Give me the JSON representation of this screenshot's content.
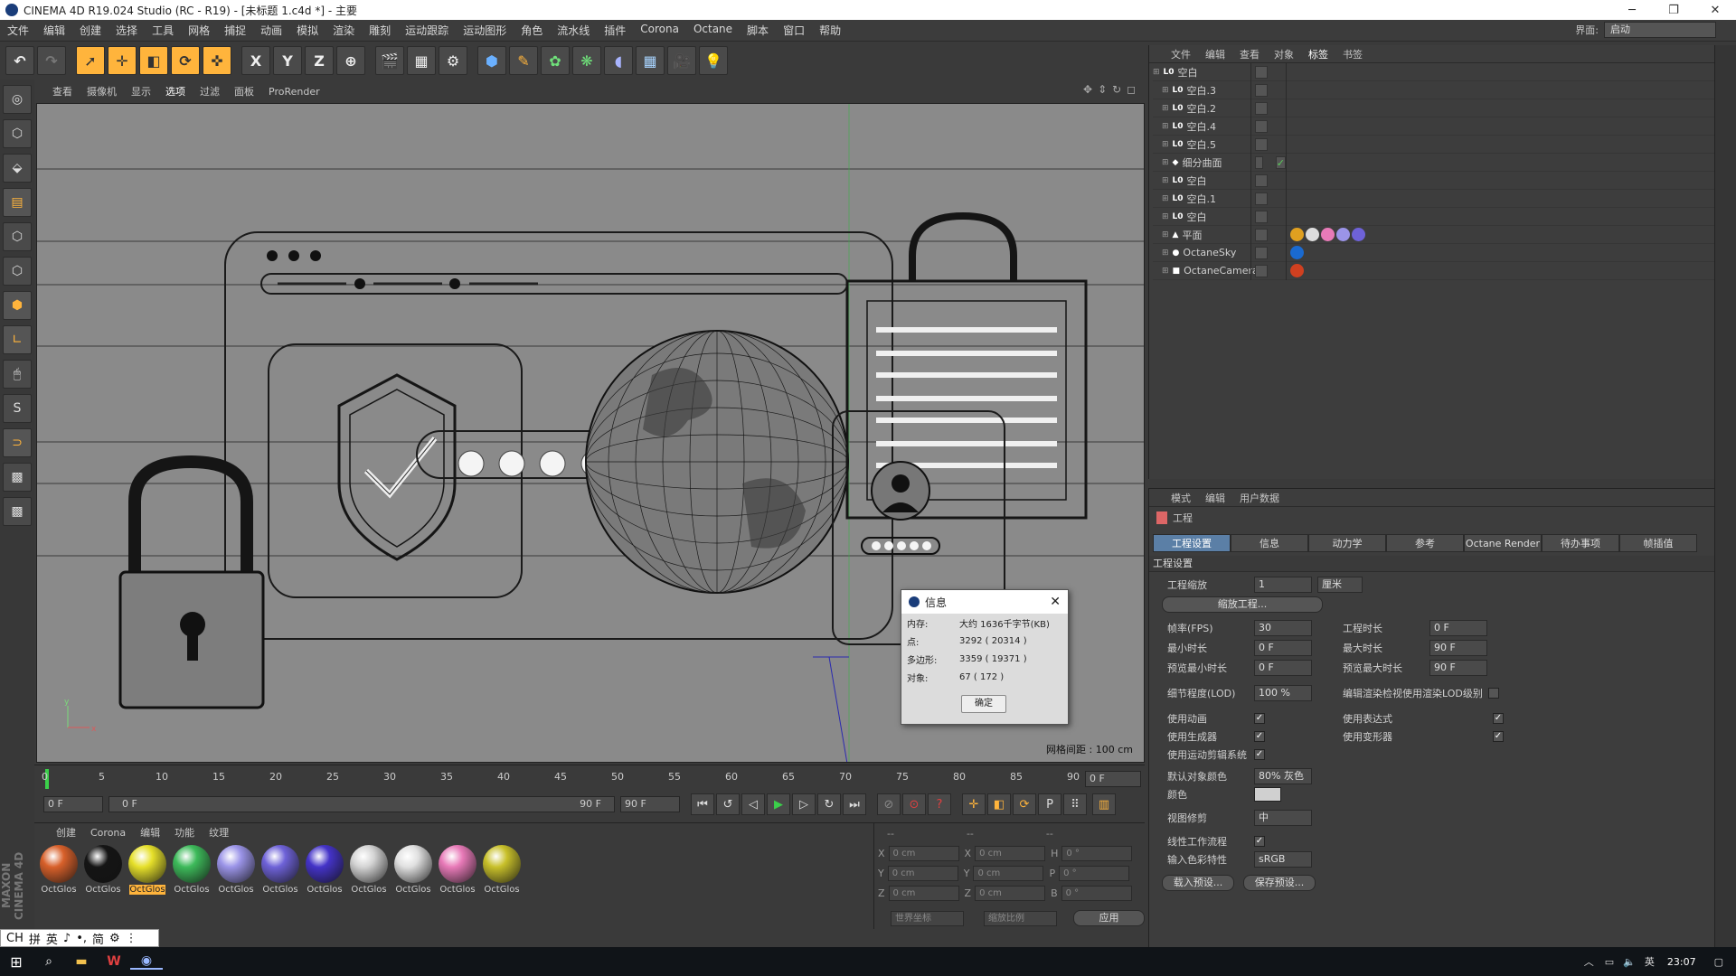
{
  "title": "CINEMA 4D R19.024 Studio (RC - R19) - [未标题 1.c4d *] - 主要",
  "menu": [
    "文件",
    "编辑",
    "创建",
    "选择",
    "工具",
    "网格",
    "捕捉",
    "动画",
    "模拟",
    "渲染",
    "雕刻",
    "运动跟踪",
    "运动图形",
    "角色",
    "流水线",
    "插件",
    "Corona",
    "Octane",
    "脚本",
    "窗口",
    "帮助"
  ],
  "layout": {
    "label": "界面:",
    "value": "启动"
  },
  "toolbar": {
    "x": "X",
    "y": "Y",
    "z": "Z"
  },
  "viewport": {
    "menu": [
      "查看",
      "摄像机",
      "显示",
      "选项",
      "过滤",
      "面板",
      "ProRender"
    ],
    "grid_label": "网格间距 : 100 cm"
  },
  "timeline": {
    "ticks": [
      "0",
      "5",
      "10",
      "15",
      "20",
      "25",
      "30",
      "35",
      "40",
      "45",
      "50",
      "55",
      "60",
      "65",
      "70",
      "75",
      "80",
      "85",
      "90"
    ],
    "current": "0 F",
    "start": "0 F",
    "range_start": "0 F",
    "range_end": "90 F",
    "end": "90 F"
  },
  "materials": {
    "menu": [
      "创建",
      "Corona",
      "编辑",
      "功能",
      "纹理"
    ],
    "items": [
      {
        "label": "OctGlos",
        "color": "#d8602a",
        "selected": false
      },
      {
        "label": "OctGlos",
        "color": "#151515",
        "selected": false
      },
      {
        "label": "OctGlos",
        "color": "#e6e02a",
        "selected": true
      },
      {
        "label": "OctGlos",
        "color": "#3dba5a",
        "selected": false
      },
      {
        "label": "OctGlos",
        "color": "#9b94e8",
        "selected": false
      },
      {
        "label": "OctGlos",
        "color": "#6e62d8",
        "selected": false
      },
      {
        "label": "OctGlos",
        "color": "#4433c8",
        "selected": false
      },
      {
        "label": "OctGlos",
        "color": "#d4d4d4",
        "selected": false
      },
      {
        "label": "OctGlos",
        "color": "#e0e0e0",
        "selected": false
      },
      {
        "label": "OctGlos",
        "color": "#e87ab8",
        "selected": false
      },
      {
        "label": "OctGlos",
        "color": "#c8c02a",
        "selected": false
      }
    ]
  },
  "coords": {
    "header": [
      "--",
      "--",
      "--"
    ],
    "rows": [
      {
        "a": "X",
        "av": "0 cm",
        "b": "X",
        "bv": "0 cm",
        "c": "H",
        "cv": "0 °"
      },
      {
        "a": "Y",
        "av": "0 cm",
        "b": "Y",
        "bv": "0 cm",
        "c": "P",
        "cv": "0 °"
      },
      {
        "a": "Z",
        "av": "0 cm",
        "b": "Z",
        "bv": "0 cm",
        "c": "B",
        "cv": "0 °"
      }
    ],
    "world": "世界坐标",
    "scale": "缩放比例",
    "apply": "应用"
  },
  "objects": {
    "menu": [
      "文件",
      "编辑",
      "查看",
      "对象",
      "标签",
      "书签"
    ],
    "items": [
      {
        "name": "空白",
        "indent": 0,
        "icon": "L0"
      },
      {
        "name": "空白.3",
        "indent": 1,
        "icon": "L0"
      },
      {
        "name": "空白.2",
        "indent": 1,
        "icon": "L0"
      },
      {
        "name": "空白.4",
        "indent": 1,
        "icon": "L0"
      },
      {
        "name": "空白.5",
        "indent": 1,
        "icon": "L0"
      },
      {
        "name": "细分曲面",
        "indent": 1,
        "icon": "◆"
      },
      {
        "name": "空白",
        "indent": 1,
        "icon": "L0"
      },
      {
        "name": "空白.1",
        "indent": 1,
        "icon": "L0"
      },
      {
        "name": "空白",
        "indent": 1,
        "icon": "L0"
      },
      {
        "name": "平面",
        "indent": 1,
        "icon": "▲"
      },
      {
        "name": "OctaneSky",
        "indent": 1,
        "icon": "●"
      },
      {
        "name": "OctaneCamera",
        "indent": 1,
        "icon": "■"
      }
    ]
  },
  "attributes": {
    "menu": [
      "模式",
      "编辑",
      "用户数据"
    ],
    "header": "工程",
    "tabs": [
      "工程设置",
      "信息",
      "动力学",
      "参考",
      "Octane Render",
      "待办事项",
      "帧插值"
    ],
    "section": "工程设置",
    "scale_label": "工程缩放",
    "scale_value": "1",
    "scale_unit": "厘米",
    "scale_button": "缩放工程...",
    "fps_label": "帧率(FPS)",
    "fps": "30",
    "time_label": "工程时长",
    "time": "0 F",
    "min_label": "最小时长",
    "min": "0 F",
    "max_label": "最大时长",
    "max": "90 F",
    "pmin_label": "预览最小时长",
    "pmin": "0 F",
    "pmax_label": "预览最大时长",
    "pmax": "90 F",
    "lod_label": "细节程度(LOD)",
    "lod": "100 %",
    "lod_render": "编辑渲染检视使用渲染LOD级别",
    "use_anim": "使用动画",
    "use_expr": "使用表达式",
    "use_gen": "使用生成器",
    "use_deform": "使用变形器",
    "use_motion": "使用运动剪辑系统",
    "def_color_label": "默认对象颜色",
    "def_color": "80% 灰色",
    "color_label": "颜色",
    "clip_label": "视图修剪",
    "clip": "中",
    "linear": "线性工作流程",
    "input_label": "输入色彩特性",
    "input": "sRGB",
    "load": "载入预设...",
    "save": "保存预设..."
  },
  "dialog": {
    "title": "信息",
    "rows": [
      {
        "k": "内存:",
        "v": "大约 1636千字节(KB)"
      },
      {
        "k": "点:",
        "v": "3292 ( 20314 )"
      },
      {
        "k": "多边形:",
        "v": "3359 ( 19371 )"
      },
      {
        "k": "对象:",
        "v": "67 ( 172 )"
      }
    ],
    "ok": "确定"
  },
  "ime": [
    "CH",
    "拼",
    "英",
    "♪",
    "•,",
    "简",
    "⚙",
    "⋮"
  ],
  "clock": "23:07"
}
